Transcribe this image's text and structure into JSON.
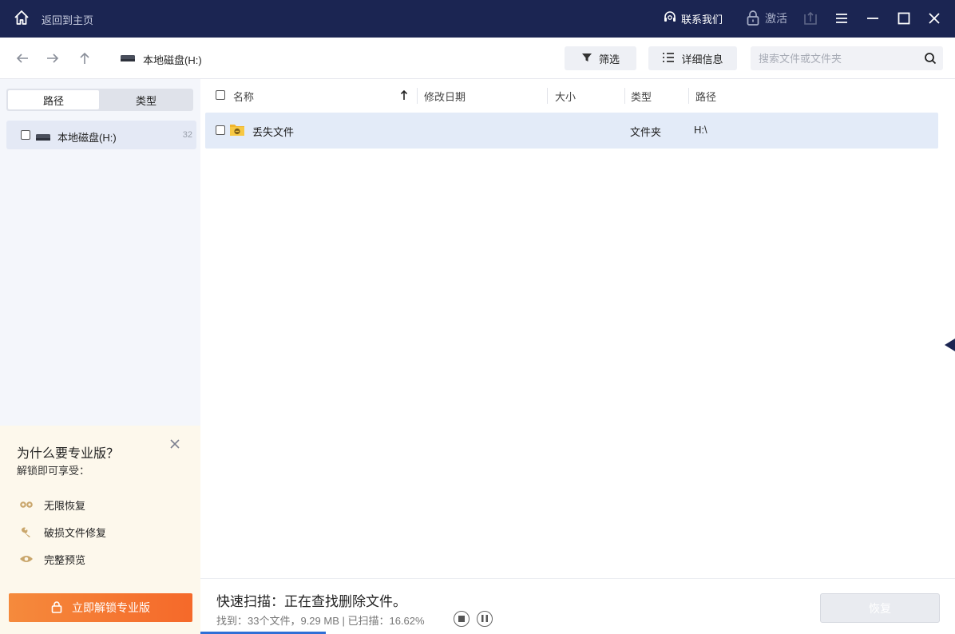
{
  "titlebar": {
    "back_home": "返回到主页",
    "contact": "联系我们",
    "activate": "激活"
  },
  "toolbar": {
    "breadcrumb": "本地磁盘(H:)",
    "filter_label": "筛选",
    "details_label": "详细信息",
    "search_placeholder": "搜索文件或文件夹"
  },
  "sidebar": {
    "tabs": [
      "路径",
      "类型"
    ],
    "active_tab": "路径",
    "tree": [
      {
        "label": "本地磁盘(H:)",
        "count": "32"
      }
    ]
  },
  "promo": {
    "title": "为什么要专业版？",
    "subtitle": "解锁即可享受：",
    "features": [
      "无限恢复",
      "破损文件修复",
      "完整预览"
    ],
    "unlock_button": "立即解锁专业版"
  },
  "list": {
    "columns": [
      "名称",
      "修改日期",
      "大小",
      "类型",
      "路径"
    ],
    "rows": [
      {
        "name": "丢失文件",
        "modified": "",
        "size": "",
        "type": "文件夹",
        "path": "H:\\"
      }
    ]
  },
  "status": {
    "title": "快速扫描：正在查找删除文件。",
    "detail": "找到：33个文件，9.29 MB | 已扫描：16.62%",
    "progress": 0.1662,
    "recover_label": "恢复"
  },
  "colors": {
    "titlebar_bg": "#1b2552",
    "accent_orange": "#f5692a",
    "selected_row": "#e3ebf8",
    "progress_blue": "#2f6fd6"
  }
}
